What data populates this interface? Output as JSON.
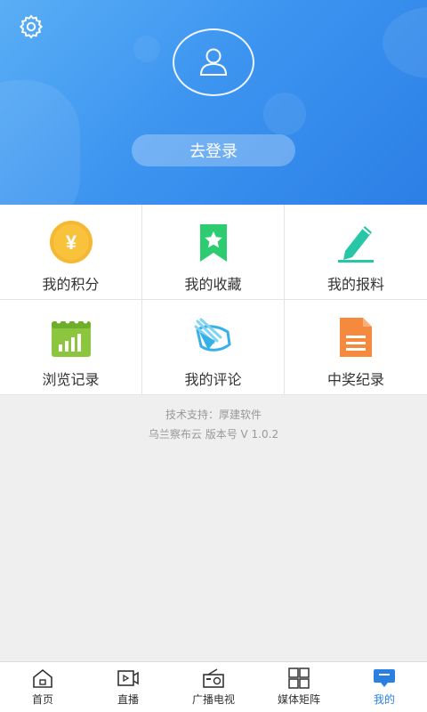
{
  "header": {
    "login_button": "去登录"
  },
  "menu": {
    "items": [
      {
        "label": "我的积分",
        "icon": "yen-coin-icon"
      },
      {
        "label": "我的收藏",
        "icon": "bookmark-star-icon"
      },
      {
        "label": "我的报料",
        "icon": "pencil-icon"
      },
      {
        "label": "浏览记录",
        "icon": "bar-chart-calendar-icon"
      },
      {
        "label": "我的评论",
        "icon": "comment-icon"
      },
      {
        "label": "中奖纪录",
        "icon": "document-icon"
      }
    ]
  },
  "info": {
    "support": "技术支持：厚建软件",
    "version": "乌兰察布云 版本号 V 1.0.2"
  },
  "tabbar": {
    "tabs": [
      {
        "label": "首页",
        "icon": "home-icon"
      },
      {
        "label": "直播",
        "icon": "video-camera-icon"
      },
      {
        "label": "广播电视",
        "icon": "radio-icon"
      },
      {
        "label": "媒体矩阵",
        "icon": "grid-icon"
      },
      {
        "label": "我的",
        "icon": "profile-icon"
      }
    ],
    "active_index": 4,
    "active_color": "#2a7fe5"
  },
  "colors": {
    "header_gradient_start": "#5aaef5",
    "header_gradient_end": "#2c7fe6",
    "coin": "#f7b731",
    "bookmark": "#2ecc71",
    "pencil": "#26c6a6",
    "chart": "#8cc63f",
    "comment": "#36b0e8",
    "document": "#f5893d"
  }
}
